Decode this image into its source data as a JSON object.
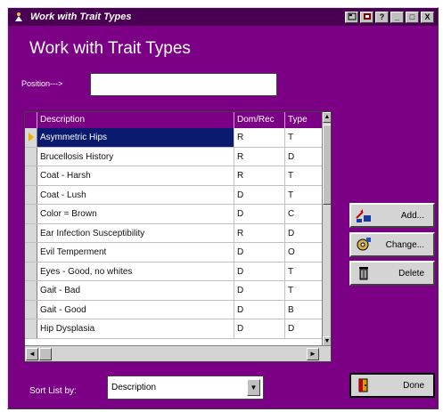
{
  "window": {
    "title": "Work with Trait Types",
    "buttons": [
      "?",
      "_",
      "□",
      "X"
    ]
  },
  "heading": "Work with Trait Types",
  "position": {
    "label": "Position--->",
    "value": ""
  },
  "grid": {
    "columns": [
      "Description",
      "Dom/Rec",
      "Type"
    ],
    "rows": [
      {
        "description": "Asymmetric Hips",
        "dom_rec": "R",
        "type": "T",
        "selected": true
      },
      {
        "description": "Brucellosis History",
        "dom_rec": "R",
        "type": "D"
      },
      {
        "description": "Coat - Harsh",
        "dom_rec": "R",
        "type": "T"
      },
      {
        "description": "Coat - Lush",
        "dom_rec": "D",
        "type": "T"
      },
      {
        "description": "Color = Brown",
        "dom_rec": "D",
        "type": "C"
      },
      {
        "description": "Ear Infection Susceptibility",
        "dom_rec": "R",
        "type": "D"
      },
      {
        "description": "Evil Temperment",
        "dom_rec": "D",
        "type": "O"
      },
      {
        "description": "Eyes - Good, no whites",
        "dom_rec": "D",
        "type": "T"
      },
      {
        "description": "Gait - Bad",
        "dom_rec": "D",
        "type": "T"
      },
      {
        "description": "Gait - Good",
        "dom_rec": "D",
        "type": "B"
      },
      {
        "description": "Hip Dysplasia",
        "dom_rec": "D",
        "type": "D"
      }
    ]
  },
  "actions": {
    "add": "Add...",
    "change": "Change...",
    "delete": "Delete",
    "done": "Done"
  },
  "sort": {
    "label": "Sort List by:",
    "value": "Description"
  },
  "colors": {
    "background": "#7b0086",
    "selection": "#0a1a6e"
  }
}
